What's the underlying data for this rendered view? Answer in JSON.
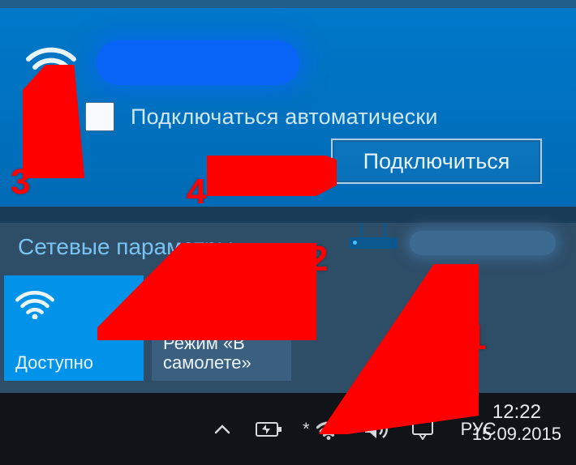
{
  "network": {
    "auto_connect_label": "Подключаться автоматически",
    "connect_button": "Подключиться"
  },
  "settings": {
    "title": "Сетевые параметры",
    "tiles": {
      "wifi": "Доступно",
      "airplane": "Режим «В самолете»"
    }
  },
  "taskbar": {
    "lang": "РУС",
    "time": "12:22",
    "date": "15.09.2015"
  },
  "annotations": {
    "a1": "1",
    "a2": "2",
    "a3": "3",
    "a4": "4"
  }
}
